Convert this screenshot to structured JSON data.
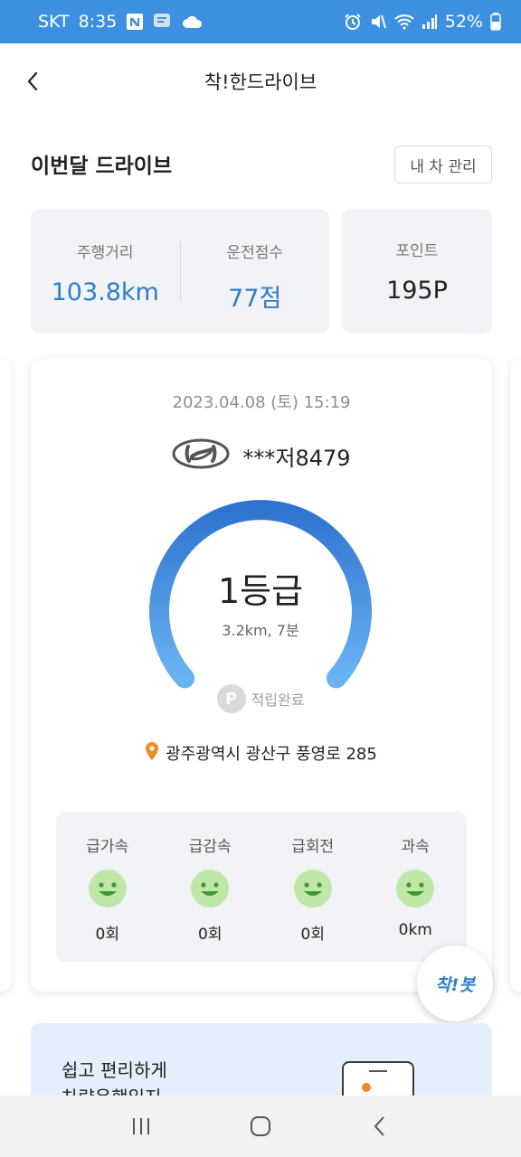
{
  "status_bar": {
    "carrier": "SKT",
    "time": "8:35",
    "battery": "52%",
    "icons": [
      "n-app-icon",
      "chat-icon",
      "cloud-icon",
      "alarm-icon",
      "mute-icon",
      "wifi-icon",
      "signal-icon",
      "battery-icon"
    ]
  },
  "header": {
    "title": "착!한드라이브",
    "back_icon": "chevron-left-icon"
  },
  "section": {
    "title": "이번달 드라이브",
    "manage_button": "내 차 관리"
  },
  "monthly_stats": {
    "distance_label": "주행거리",
    "distance_value": "103.8km",
    "score_label": "운전점수",
    "score_value": "77점",
    "points_label": "포인트",
    "points_value": "195P"
  },
  "drive_card": {
    "date": "2023.04.08 (토) 15:19",
    "car_logo": "hyundai-logo",
    "plate": "***저8479",
    "grade": "1등급",
    "trip_info": "3.2km, 7분",
    "point_badge_letter": "P",
    "point_status": "적립완료",
    "location": "광주광역시 광산구 풍영로 285",
    "behaviors": [
      {
        "label": "급가속",
        "value": "0회",
        "icon": "smiley-icon"
      },
      {
        "label": "급감속",
        "value": "0회",
        "icon": "smiley-icon"
      },
      {
        "label": "급회전",
        "value": "0회",
        "icon": "smiley-icon"
      },
      {
        "label": "과속",
        "value": "0km",
        "icon": "smiley-icon"
      }
    ]
  },
  "fab": {
    "label": "착!봇"
  },
  "promo": {
    "line1": "쉽고 편리하게",
    "line2": "차량운행일지"
  },
  "colors": {
    "status_bar": "#3d8fe0",
    "accent_blue": "#2f7bcf",
    "card_bg": "#f1f3f6",
    "smiley_green": "#bfe8a8",
    "location_pin": "#f08a24"
  }
}
